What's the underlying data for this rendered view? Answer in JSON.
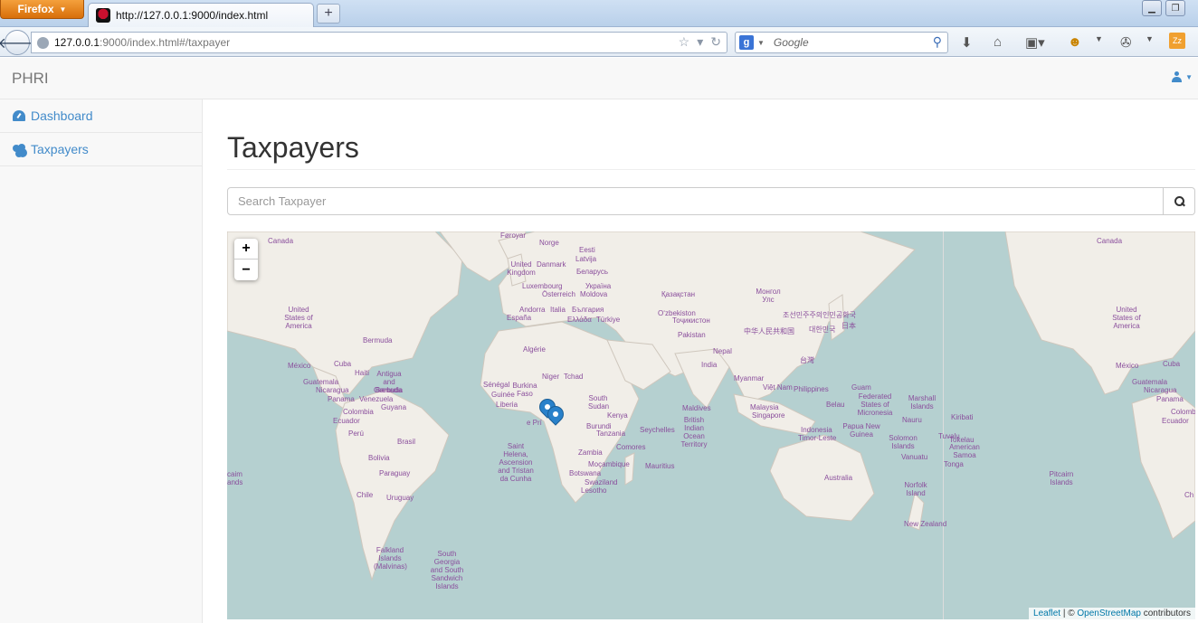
{
  "browser": {
    "menu_button": "Firefox",
    "tab_title": "http://127.0.0.1:9000/index.html",
    "new_tab": "+",
    "url_host": "127.0.0.1",
    "url_rest": ":9000/index.html#/taxpayer",
    "search_engine": "g",
    "search_placeholder": "Google"
  },
  "app": {
    "brand": "PHRI",
    "sidebar": {
      "items": [
        {
          "label": "Dashboard",
          "icon": "dashboard-icon"
        },
        {
          "label": "Taxpayers",
          "icon": "users-icon"
        }
      ]
    },
    "page_title": "Taxpayers",
    "search": {
      "placeholder": "Search Taxpayer"
    }
  },
  "map": {
    "zoom_in": "+",
    "zoom_out": "−",
    "attribution": {
      "leaflet": "Leaflet",
      "separator": " | © ",
      "osm": "OpenStreetMap",
      "suffix": " contributors"
    },
    "labels": {
      "canada_l": "Canada",
      "usa_l": "United States of America",
      "bermuda": "Bermuda",
      "mexico_l": "México",
      "cuba_l": "Cuba",
      "haiti": "Haiti",
      "antigua": "Antigua and Barbuda",
      "guatemala_l": "Guatemala",
      "nicaragua_l": "Nicaragua",
      "grenada": "Grenada",
      "panama_l": "Panama",
      "venezuela": "Venezuela",
      "guyana": "Guyana",
      "colombia_l": "Colombia",
      "ecuador_l": "Ecuador",
      "peru": "Perú",
      "brasil": "Brasil",
      "bolivia": "Bolivia",
      "paraguay": "Paraguay",
      "chile": "Chile",
      "uruguay": "Uruguay",
      "falkland": "Falkland Islands (Malvinas)",
      "south_georgia": "South Georgia and South Sandwich Islands",
      "faroyar": "Føroyar",
      "norge": "Norge",
      "eesti": "Eesti",
      "latvija": "Latvija",
      "uk": "United Kingdom",
      "danmark": "Danmark",
      "belarus": "Беларусь",
      "luxembourg": "Luxembourg",
      "osterreich": "Österreich",
      "ukraina": "Україна",
      "moldova": "Moldova",
      "andorra": "Andorra",
      "italia": "Italia",
      "bulgaria": "България",
      "espana": "España",
      "ellada": "Ελλάδα",
      "turkiye": "Türkiye",
      "kazakhstan": "Қазақстан",
      "mongol": "Монгол Улс",
      "uzbekistan": "O‘zbekiston",
      "tojikiston": "Тоҷикистон",
      "korea": "조선민주주의인민공화국",
      "korea_s": "대한민국",
      "japan": "日本",
      "china": "中华人民共和国",
      "taiwan": "台灣",
      "pakistan": "Pakistan",
      "india": "India",
      "nepal": "Nepal",
      "myanmar": "Myanmar",
      "vietnam": "Việt Nam",
      "philippines": "Philippines",
      "malaysia": "Malaysia",
      "singapore": "Singapore",
      "indonesia": "Indonesia",
      "timor": "Timor-Leste",
      "guam": "Guam",
      "micronesia": "Federated States of Micronesia",
      "marshall": "Marshall Islands",
      "nauru": "Nauru",
      "papua": "Papua New Guinea",
      "solomon": "Solomon Islands",
      "vanuatu": "Vanuatu",
      "australia": "Australia",
      "norfolk": "Norfolk Island",
      "nz": "New Zealand",
      "belau": "Belau",
      "kiribati": "Kiribati",
      "tuvalu": "Tuvalu",
      "tokelau": "Tokelau",
      "am_samoa": "American Samoa",
      "tonga": "Tonga",
      "algerie": "Algérie",
      "niger": "Niger",
      "tchad": "Tchad",
      "senegal": "Sénégal",
      "burkina": "Burkina Faso",
      "guinee": "Guinée",
      "liberia": "Liberia",
      "south_sudan": "South Sudan",
      "kenya": "Kenya",
      "burundi": "Burundi",
      "tanzania": "Tanzania",
      "zambia": "Zambia",
      "mozambique": "Moçambique",
      "botswana": "Botswana",
      "swaziland": "Swaziland",
      "lesotho": "Lesotho",
      "comores": "Comores",
      "seychelles": "Seychelles",
      "maldives": "Maldives",
      "biot": "British Indian Ocean Territory",
      "mauritius": "Mauritius",
      "saint_helena": "Saint Helena, Ascension and Tristan da Cunha",
      "canada_r": "Canada",
      "usa_r": "United States of America",
      "mexico_r": "México",
      "cuba_r": "Cuba",
      "guatemala_r": "Guatemala",
      "nicaragua_r": "Nicaragua",
      "panama_r": "Panama",
      "colombia_r": "Colombia",
      "ecuador_r": "Ecuador",
      "pitcairn": "Pitcairn Islands",
      "chile_r": "Ch",
      "caim": "caim ands",
      "sao": "e Prí"
    }
  }
}
